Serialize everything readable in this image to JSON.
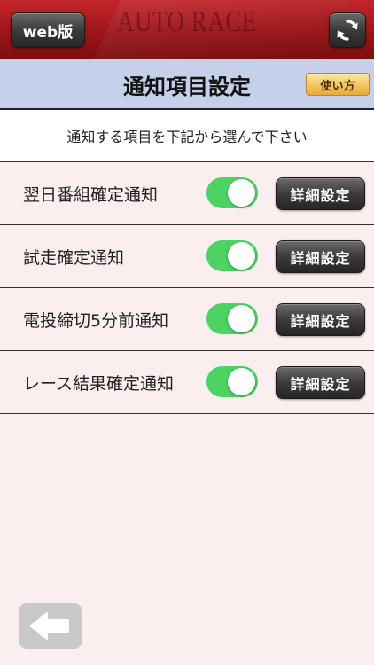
{
  "topbar": {
    "brand": "AUTO RACE",
    "web_button": "web版"
  },
  "header": {
    "title": "通知項目設定",
    "howto_button": "使い方"
  },
  "instruction": "通知する項目を下記から選んで下さい",
  "settings": [
    {
      "label": "翌日番組確定通知",
      "enabled": true,
      "detail_button": "詳細設定"
    },
    {
      "label": "試走確定通知",
      "enabled": true,
      "detail_button": "詳細設定"
    },
    {
      "label": "電投締切5分前通知",
      "enabled": true,
      "detail_button": "詳細設定"
    },
    {
      "label": "レース結果確定通知",
      "enabled": true,
      "detail_button": "詳細設定"
    }
  ],
  "colors": {
    "topbar_red": "#9e1418",
    "header_blue": "#c7d0ea",
    "toggle_on": "#4cd364",
    "background": "#fbeeee"
  },
  "icons": {
    "refresh": "refresh-icon",
    "back": "back-arrow-icon"
  }
}
